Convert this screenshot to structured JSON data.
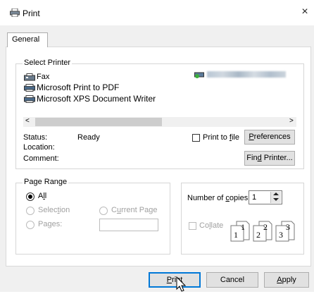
{
  "window": {
    "title": "Print",
    "close_glyph": "×"
  },
  "tabs": [
    {
      "label": "General"
    }
  ],
  "select_printer": {
    "legend": "Select Printer",
    "printers": [
      {
        "name": "Fax",
        "icon": "fax-icon"
      },
      {
        "name": "Microsoft Print to PDF",
        "icon": "printer-icon"
      },
      {
        "name": "Microsoft XPS Document Writer",
        "icon": "printer-icon"
      }
    ],
    "scroll_left": "<",
    "scroll_right": ">"
  },
  "status": {
    "status_label": "Status:",
    "status_value": "Ready",
    "location_label": "Location:",
    "location_value": "",
    "comment_label": "Comment:",
    "comment_value": ""
  },
  "print_to_file": {
    "label_pre": "Print to ",
    "label_ul": "f",
    "label_post": "ile",
    "checked": false
  },
  "buttons": {
    "preferences": {
      "pre": "",
      "ul": "P",
      "post": "references"
    },
    "find_printer": {
      "pre": "Fin",
      "ul": "d",
      "post": " Printer..."
    },
    "print": {
      "pre": "",
      "ul": "P",
      "post": "rint"
    },
    "cancel": "Cancel",
    "apply": {
      "pre": "",
      "ul": "A",
      "post": "pply"
    }
  },
  "page_range": {
    "legend": "Page Range",
    "all": {
      "pre": "A",
      "ul": "l",
      "post": "l",
      "selected": true
    },
    "selection": {
      "pre": "Selec",
      "ul": "t",
      "post": "ion",
      "selected": false
    },
    "current_page": {
      "pre": "C",
      "ul": "u",
      "post": "rrent Page",
      "selected": false
    },
    "pages": {
      "pre": "Pa",
      "ul": "g",
      "post": "es:",
      "selected": false
    },
    "pages_value": ""
  },
  "copies": {
    "label_pre": "Number of ",
    "label_ul": "c",
    "label_post": "opies:",
    "value": "1",
    "collate": {
      "pre": "Co",
      "ul": "l",
      "post": "late",
      "checked": false
    }
  },
  "colors": {
    "accent": "#0078d7",
    "panel_bg": "#f0f0f0"
  }
}
